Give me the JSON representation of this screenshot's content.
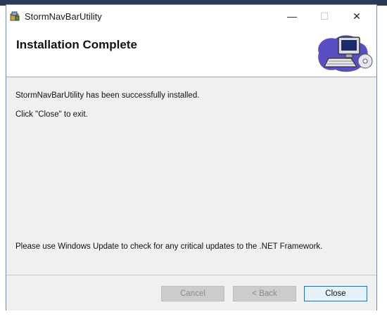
{
  "window": {
    "title": "StormNavBarUtility",
    "controls": {
      "minimize": "—",
      "maximize": "☐",
      "close": "✕"
    }
  },
  "header": {
    "title": "Installation Complete"
  },
  "content": {
    "message_installed": "StormNavBarUtility has been successfully installed.",
    "message_close": "Click \"Close\" to exit.",
    "message_update": "Please use Windows Update to check for any critical updates to the .NET Framework."
  },
  "footer": {
    "cancel_label": "Cancel",
    "back_label": "< Back",
    "close_label": "Close"
  },
  "colors": {
    "accent": "#0078d7",
    "panel": "#f0f0f0",
    "disabled_text": "#8a8a8a"
  },
  "icons": {
    "app": "installer-icon",
    "header": "computer-cd-icon"
  }
}
